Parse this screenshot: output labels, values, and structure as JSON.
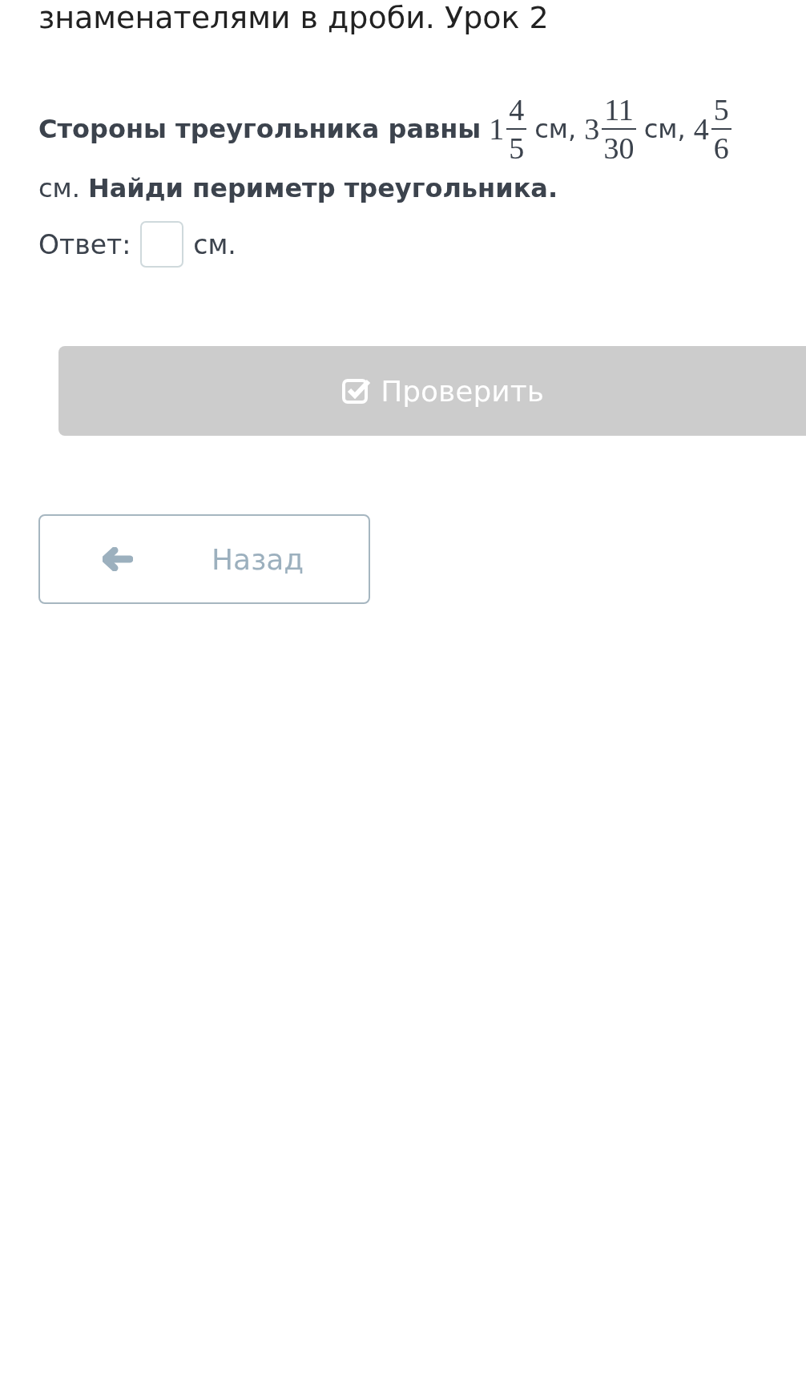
{
  "lesson_title": "знаменателями в дроби. Урок 2",
  "question": [
    {
      "kind": "text",
      "text": "Стороны треугольника равны",
      "bold": true
    },
    {
      "kind": "mixed",
      "whole": "1",
      "num": "4",
      "den": "5"
    },
    {
      "kind": "text",
      "text": "см,",
      "bold": false
    },
    {
      "kind": "mixed",
      "whole": "3",
      "num": "11",
      "den": "30"
    },
    {
      "kind": "text",
      "text": "см,",
      "bold": false
    },
    {
      "kind": "mixed",
      "whole": "4",
      "num": "5",
      "den": "6"
    },
    {
      "kind": "text",
      "text": "см.",
      "bold": false
    },
    {
      "kind": "text",
      "text": "Найди периметр треугольника.",
      "bold": true
    }
  ],
  "answer": {
    "label": "Ответ:",
    "unit": "см."
  },
  "check_button": {
    "label": "Проверить",
    "disabled": true
  },
  "back_button": {
    "label": "Назад"
  }
}
